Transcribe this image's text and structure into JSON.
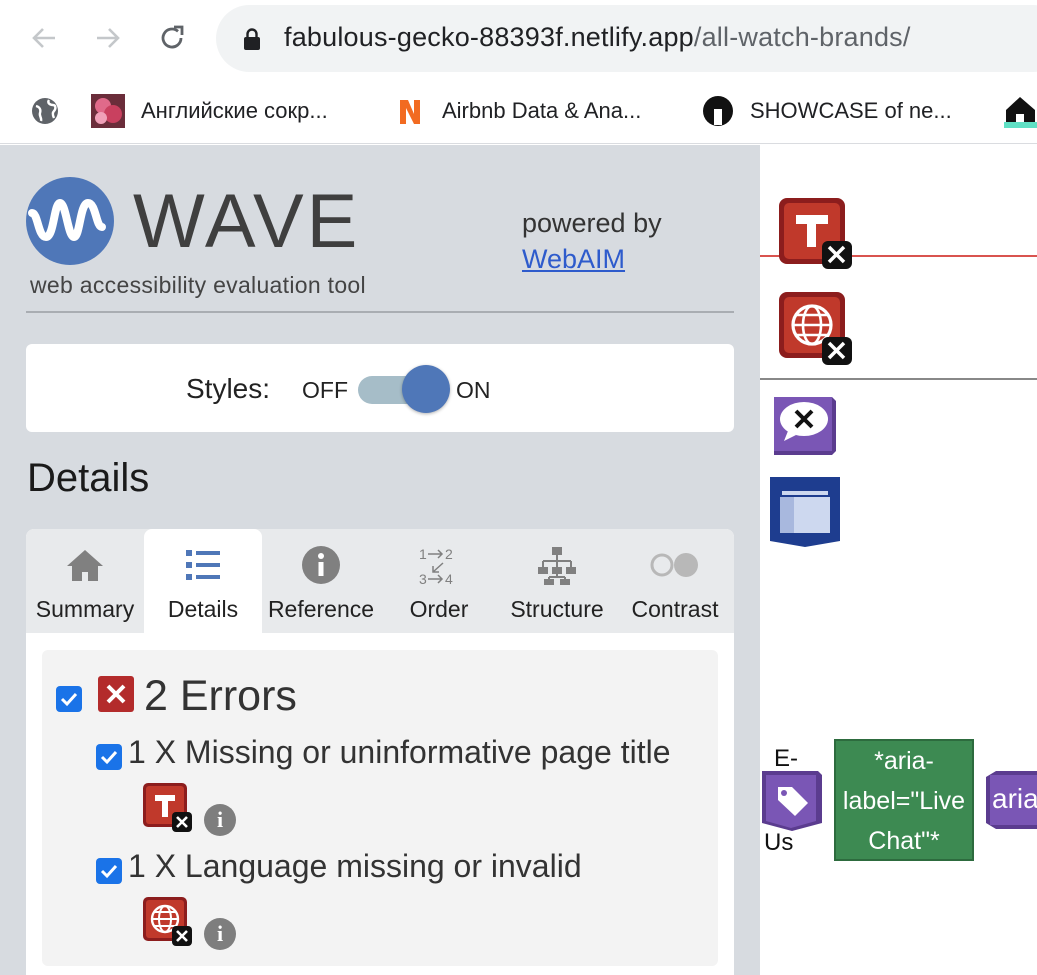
{
  "browser": {
    "url_host": "fabulous-gecko-88393f.netlify.app",
    "url_path": "/all-watch-brands/",
    "bookmarks": [
      {
        "label": "",
        "icon": "globe-icon"
      },
      {
        "label": "Английские сокр...",
        "icon": "flower-favicon"
      },
      {
        "label": "Airbnb Data & Ana...",
        "icon": "n-favicon"
      },
      {
        "label": "SHOWCASE of ne...",
        "icon": "circle-favicon"
      },
      {
        "label": "",
        "icon": "house-favicon"
      }
    ]
  },
  "wave": {
    "logo_word": "WAVE",
    "logo_subtitle": "web accessibility evaluation tool",
    "powered_by": "powered by",
    "webaim_link": "WebAIM",
    "styles_label": "Styles:",
    "styles_off": "OFF",
    "styles_on": "ON",
    "styles_enabled": true,
    "details_heading": "Details",
    "tabs": [
      {
        "label": "Summary",
        "icon": "home-icon",
        "active": false
      },
      {
        "label": "Details",
        "icon": "list-icon",
        "active": true
      },
      {
        "label": "Reference",
        "icon": "info-icon",
        "active": false
      },
      {
        "label": "Order",
        "icon": "order-icon",
        "active": false
      },
      {
        "label": "Structure",
        "icon": "structure-icon",
        "active": false
      },
      {
        "label": "Contrast",
        "icon": "contrast-icon",
        "active": false
      }
    ],
    "errors": {
      "title": "2 Errors",
      "items": [
        {
          "label": "1 X Missing or uninformative page title",
          "icon": "title-error-icon"
        },
        {
          "label": "1 X Language missing or invalid",
          "icon": "language-error-icon"
        }
      ]
    }
  },
  "page": {
    "aria_label_text": "*aria-label=\"Live Chat\"*",
    "aria_partial": "aria",
    "text_e": "E-",
    "text_us": "Us"
  },
  "colors": {
    "wave_blue": "#4f77b8",
    "error_red": "#b32b2b",
    "aria_green": "#3d8a52",
    "purple": "#5b3c8f"
  }
}
